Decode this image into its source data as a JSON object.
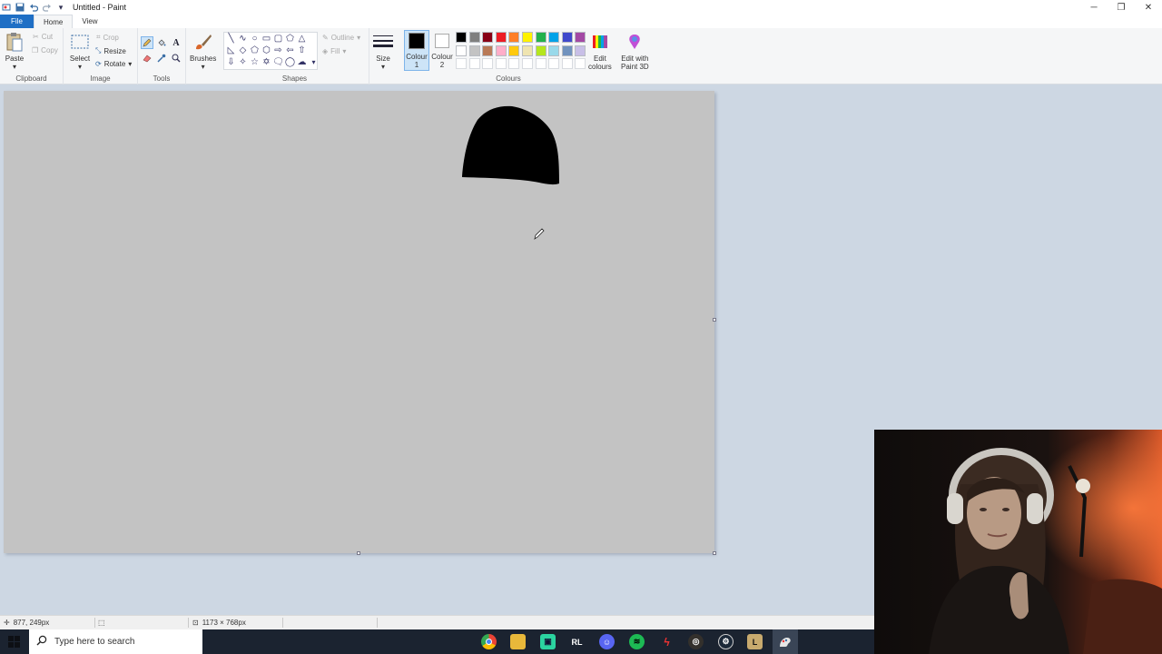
{
  "window": {
    "title": "Untitled - Paint",
    "quick_access": [
      "paint-app-icon",
      "save-icon",
      "undo-icon",
      "redo-icon",
      "customize-qat-icon"
    ],
    "controls": [
      "minimize-icon",
      "restore-icon",
      "close-icon"
    ]
  },
  "tabs": [
    {
      "label": "File"
    },
    {
      "label": "Home"
    },
    {
      "label": "View"
    }
  ],
  "ribbon": {
    "clipboard": {
      "label": "Clipboard",
      "paste": "Paste",
      "cut": "Cut",
      "copy": "Copy"
    },
    "image": {
      "label": "Image",
      "select": "Select",
      "crop": "Crop",
      "resize": "Resize",
      "rotate": "Rotate"
    },
    "tools": {
      "label": "Tools",
      "items": [
        "pencil-icon",
        "fill-icon",
        "text-icon",
        "eraser-icon",
        "color-picker-icon",
        "magnifier-icon"
      ],
      "active": "pencil-icon"
    },
    "brushes": {
      "label": "Brushes"
    },
    "shapes": {
      "label": "Shapes",
      "outline": "Outline",
      "fill": "Fill"
    },
    "size": {
      "label": "Size"
    },
    "colour1": {
      "label_line1": "Colour",
      "label_line2": "1",
      "value": "#000000"
    },
    "colour2": {
      "label_line1": "Colour",
      "label_line2": "2",
      "value": "#ffffff"
    },
    "colours": {
      "label": "Colours",
      "row1": [
        "#000000",
        "#7f7f7f",
        "#880015",
        "#ed1c24",
        "#ff7f27",
        "#fff200",
        "#22b14c",
        "#00a2e8",
        "#3f48cc",
        "#a349a4"
      ],
      "row2": [
        "#ffffff",
        "#c3c3c3",
        "#b97a57",
        "#ffaec9",
        "#ffc90e",
        "#efe4b0",
        "#b5e61d",
        "#99d9ea",
        "#7092be",
        "#c8bfe7"
      ]
    },
    "edit_colours": {
      "line1": "Edit",
      "line2": "colours"
    },
    "paint3d": {
      "line1": "Edit with",
      "line2": "Paint 3D"
    }
  },
  "canvas": {
    "background": "#c3c3c3",
    "stroke_color": "#000000"
  },
  "status": {
    "cursor_pos": "877, 249px",
    "image_size": "1173 × 768px"
  },
  "taskbar": {
    "search_placeholder": "Type here to search",
    "apps": [
      "chrome-icon",
      "file-explorer-icon",
      "streamlabs-icon",
      "rocket-league-icon",
      "discord-icon",
      "spotify-icon",
      "lightning-app-icon",
      "obs-icon",
      "steam-icon",
      "league-icon",
      "paint-icon"
    ]
  }
}
